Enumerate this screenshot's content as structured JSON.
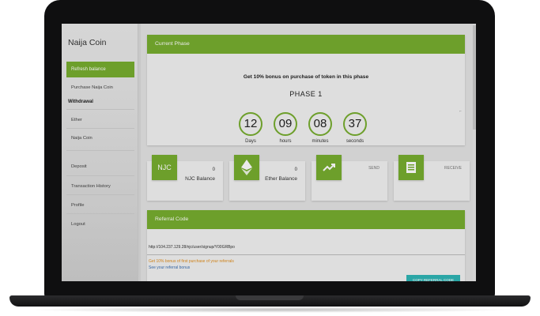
{
  "sidebar": {
    "brand": "Naija Coin",
    "items": [
      {
        "label": "Refresh balance",
        "active": true
      },
      {
        "label": "Purchase Naija Coin"
      },
      {
        "label": "Withdrawal",
        "section": true
      },
      {
        "label": "Ether"
      },
      {
        "label": "Naija Coin"
      },
      {
        "label": "Deposit"
      },
      {
        "label": "Transaction History"
      },
      {
        "label": "Profile"
      },
      {
        "label": "Logout"
      }
    ]
  },
  "phase": {
    "header": "Current Phase",
    "bonus": "Get 10% bonus on purchase of token in this phase",
    "title": "PHASE 1",
    "timer": [
      {
        "value": "12",
        "label": "Days"
      },
      {
        "value": "09",
        "label": "hours"
      },
      {
        "value": "08",
        "label": "minutes"
      },
      {
        "value": "37",
        "label": "seconds"
      }
    ]
  },
  "stats": {
    "njc": {
      "icon_text": "NJC",
      "value": "0",
      "label": "NJC Balance"
    },
    "ether": {
      "icon": "ethereum-icon",
      "value": "0",
      "label": "Ether Balance"
    },
    "send": {
      "icon": "trend-up-icon",
      "label": "SEND"
    },
    "receive": {
      "icon": "document-icon",
      "label": "RECEIVE"
    }
  },
  "referral": {
    "header": "Referral Code",
    "url": "http://104.237.129.28/njc/user/signup/Y00GRBpo",
    "bonus_note": "Get 10% bonus of first purchase of your referrals",
    "see_bonus": "See your referral bonus",
    "copy_button": "COPY REFERRAL CODE"
  },
  "colors": {
    "accent": "#77ad2f",
    "copy_button": "#2fb5b5",
    "link": "#3b6fb1",
    "note": "#e08d1c"
  }
}
